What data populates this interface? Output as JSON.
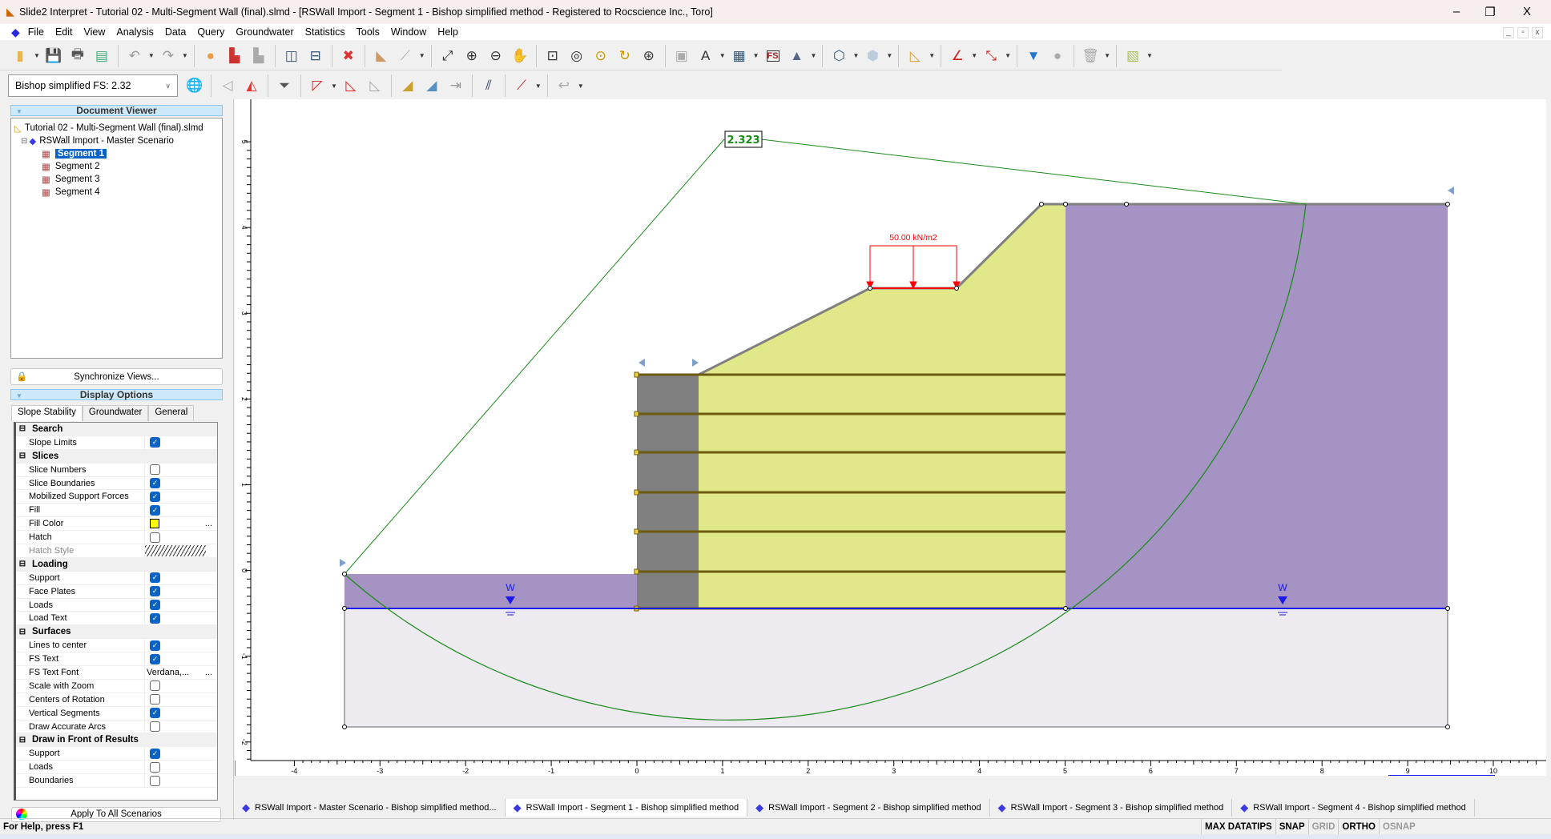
{
  "window": {
    "title": "Slide2 Interpret - Tutorial 02 - Multi-Segment Wall (final).slmd - [RSWall Import - Segment 1 - Bishop simplified method - Registered to Rocscience Inc., Toro]",
    "minimize": "–",
    "restore": "❐",
    "close": "X"
  },
  "menu": [
    "File",
    "Edit",
    "View",
    "Analysis",
    "Data",
    "Query",
    "Groundwater",
    "Statistics",
    "Tools",
    "Window",
    "Help"
  ],
  "toolbar1": [
    {
      "n": "open-folder-icon",
      "g": "▮",
      "c": "#e8b64a",
      "dd": true
    },
    {
      "n": "save-icon",
      "g": "💾",
      "c": "#335"
    },
    {
      "n": "print-icon",
      "g": "🖶",
      "c": "#555"
    },
    {
      "n": "print-preview-icon",
      "g": "▤",
      "c": "#4a7"
    },
    "sep",
    {
      "n": "undo-icon",
      "g": "↶",
      "c": "#999",
      "dd": true
    },
    {
      "n": "redo-icon",
      "g": "↷",
      "c": "#999",
      "dd": true
    },
    "sep",
    {
      "n": "color-wheel-icon",
      "g": "●",
      "c": "#e94"
    },
    {
      "n": "material-colors-icon",
      "g": "▙",
      "c": "#c33"
    },
    {
      "n": "grayscale-icon",
      "g": "▙",
      "c": "#aaa"
    },
    "sep",
    {
      "n": "tile-vertical-icon",
      "g": "◫",
      "c": "#357"
    },
    {
      "n": "tile-horizontal-icon",
      "g": "⊟",
      "c": "#357"
    },
    "sep",
    {
      "n": "close-view-icon",
      "g": "✖",
      "c": "#d33"
    },
    "sep",
    {
      "n": "slope-icon",
      "g": "◣",
      "c": "#c96"
    },
    {
      "n": "water-table-icon",
      "g": "⟋",
      "c": "#aaa",
      "dd": true
    },
    "sep",
    {
      "n": "zoom-all-icon",
      "g": "⤢",
      "c": "#333"
    },
    {
      "n": "zoom-in-icon",
      "g": "⊕",
      "c": "#333"
    },
    {
      "n": "zoom-out-icon",
      "g": "⊖",
      "c": "#333"
    },
    {
      "n": "pan-icon",
      "g": "✋",
      "c": "#c96"
    },
    "sep",
    {
      "n": "zoom-window-icon",
      "g": "⊡",
      "c": "#333"
    },
    {
      "n": "zoom-center-icon",
      "g": "◎",
      "c": "#333"
    },
    {
      "n": "zoom-previous-icon",
      "g": "⊙",
      "c": "#c90"
    },
    {
      "n": "zoom-extents-icon",
      "g": "↻",
      "c": "#c90"
    },
    {
      "n": "zoom-lock-icon",
      "g": "⊛",
      "c": "#333"
    },
    "sep",
    {
      "n": "text-box-icon",
      "g": "▣",
      "c": "#aaa"
    },
    {
      "n": "annotation-icon",
      "g": "A",
      "c": "#333",
      "dd": true
    },
    {
      "n": "table-icon",
      "g": "▦",
      "c": "#357",
      "dd": true
    },
    {
      "n": "fs-label-icon",
      "g": "FS",
      "c": "#a22"
    },
    {
      "n": "image-icon",
      "g": "▲",
      "c": "#568",
      "dd": true
    },
    "sep",
    {
      "n": "polygon-icon",
      "g": "⬡",
      "c": "#357",
      "dd": true
    },
    {
      "n": "hexagon-icon",
      "g": "⬢",
      "c": "#bcd",
      "dd": true
    },
    "sep",
    {
      "n": "ruler-triangle-icon",
      "g": "◺",
      "c": "#d9a030",
      "dd": true
    },
    "sep",
    {
      "n": "angle-icon",
      "g": "∠",
      "c": "#c22",
      "dd": true
    },
    {
      "n": "dimension-icon",
      "g": "⤡",
      "c": "#c22",
      "dd": true
    },
    "sep",
    {
      "n": "water-level-icon",
      "g": "▼",
      "c": "#2277cc"
    },
    {
      "n": "sphere-icon",
      "g": "●",
      "c": "#aaa"
    },
    "sep",
    {
      "n": "delete-icon",
      "g": "🗑",
      "c": "#aaa",
      "dd": true
    },
    "sep",
    {
      "n": "layers-icon",
      "g": "▧",
      "c": "#a8c060",
      "dd": true
    }
  ],
  "toolbar2": {
    "fs_select": "Bishop simplified FS:  2.32",
    "icons": [
      {
        "n": "global-minimum-icon",
        "g": "🌐",
        "c": "#2a6"
      },
      "sep",
      {
        "n": "all-surfaces-icon",
        "g": "◁",
        "c": "#aaa"
      },
      {
        "n": "surface-colors-icon",
        "g": "◭",
        "c": "#e33"
      },
      "sep",
      {
        "n": "filter-surfaces-icon",
        "g": "⏷",
        "c": "#555"
      },
      "sep",
      {
        "n": "add-surface-icon",
        "g": "◸",
        "c": "#d22",
        "dd": true
      },
      {
        "n": "surface-icon",
        "g": "◺",
        "c": "#d22"
      },
      {
        "n": "delete-surface-icon",
        "g": "◺",
        "c": "#aaa"
      },
      "sep",
      {
        "n": "slice-data-icon",
        "g": "◢",
        "c": "#c9a030"
      },
      {
        "n": "slice-forces-icon",
        "g": "◢",
        "c": "#5a90c0"
      },
      {
        "n": "support-force-icon",
        "g": "⇥",
        "c": "#999"
      },
      "sep",
      {
        "n": "force-diagram-icon",
        "g": "⫽",
        "c": "#235"
      },
      "sep",
      {
        "n": "support-icon",
        "g": "⟋",
        "c": "#c22",
        "dd": true
      },
      "sep",
      {
        "n": "probabilistic-icon",
        "g": "↩",
        "c": "#aaa",
        "dd": true
      }
    ]
  },
  "doc_viewer": {
    "title": "Document Viewer",
    "root": "Tutorial 02 - Multi-Segment Wall (final).slmd",
    "scenario": "RSWall Import - Master Scenario",
    "segments": [
      "Segment 1",
      "Segment 2",
      "Segment 3",
      "Segment 4"
    ],
    "sync": "Synchronize Views..."
  },
  "display_options": {
    "title": "Display Options",
    "tabs": [
      "Slope Stability",
      "Groundwater",
      "General"
    ],
    "rows": [
      {
        "cat": "Search"
      },
      {
        "l": "Slope Limits",
        "v": true
      },
      {
        "cat": "Slices"
      },
      {
        "l": "Slice Numbers",
        "v": false
      },
      {
        "l": "Slice Boundaries",
        "v": true
      },
      {
        "l": "Mobilized Support Forces",
        "v": true
      },
      {
        "l": "Fill",
        "v": true
      },
      {
        "l": "Fill Color",
        "color": "#ffff00"
      },
      {
        "l": "Hatch",
        "v": false
      },
      {
        "l": "Hatch Style",
        "hatch": true
      },
      {
        "cat": "Loading"
      },
      {
        "l": "Support",
        "v": true
      },
      {
        "l": "Face Plates",
        "v": true
      },
      {
        "l": "Loads",
        "v": true
      },
      {
        "l": "Load Text",
        "v": true
      },
      {
        "cat": "Surfaces"
      },
      {
        "l": "Lines to center",
        "v": true
      },
      {
        "l": "FS Text",
        "v": true
      },
      {
        "l": "FS Text Font",
        "text": "Verdana,..."
      },
      {
        "l": "Scale with Zoom",
        "v": false
      },
      {
        "l": "Centers of Rotation",
        "v": false
      },
      {
        "l": "Vertical Segments",
        "v": true
      },
      {
        "l": "Draw Accurate Arcs",
        "v": false
      },
      {
        "cat": "Draw in Front of Results"
      },
      {
        "l": "Support",
        "v": true
      },
      {
        "l": "Loads",
        "v": false
      },
      {
        "l": "Boundaries",
        "v": false
      }
    ],
    "apply": "Apply To All Scenarios"
  },
  "model": {
    "fs": "2.323",
    "load": "50.00 kN/m2",
    "water_marker": "W",
    "colors": {
      "fill": "#e0e88a",
      "wall": "#808080",
      "purple": "#a493c3",
      "foundation": "#edeaf0",
      "reinforcement": "#6b5a10",
      "slip": "#1a8a1a",
      "water": "#1a1aee",
      "load": "#ff0000"
    }
  },
  "axes": {
    "x_ticks": [
      -4,
      -3,
      -2,
      -1,
      0,
      1,
      2,
      3,
      4,
      5,
      6,
      7,
      8,
      9,
      10
    ],
    "y_ticks": [
      5,
      4,
      3,
      2,
      1,
      0,
      -1,
      -2
    ]
  },
  "bottom_tabs": [
    "RSWall Import - Master Scenario - Bishop simplified method...",
    "RSWall Import - Segment 1 - Bishop simplified method",
    "RSWall Import - Segment 2 - Bishop simplified method",
    "RSWall Import - Segment 3 - Bishop simplified method",
    "RSWall Import - Segment 4 - Bishop simplified method"
  ],
  "status": {
    "help": "For Help, press F1",
    "indicators": [
      {
        "t": "MAX DATATIPS",
        "on": true
      },
      {
        "t": "SNAP",
        "on": true
      },
      {
        "t": "GRID",
        "on": false
      },
      {
        "t": "ORTHO",
        "on": true
      },
      {
        "t": "OSNAP",
        "on": false
      }
    ]
  }
}
